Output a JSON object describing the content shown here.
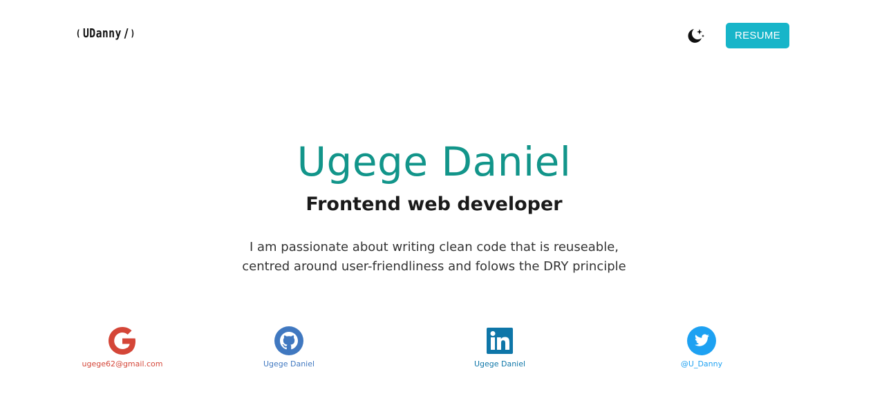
{
  "header": {
    "logo_open": "(",
    "logo_text": "UDanny",
    "logo_slash": "/",
    "logo_close": ")",
    "theme_icon": "moon-stars-icon",
    "resume_label": "RESUME"
  },
  "hero": {
    "name": "Ugege Daniel",
    "role": "Frontend web developer",
    "bio_line1": "I am passionate about writing clean code that is reuseable,",
    "bio_line2": "centred around user-friendliness and folows the DRY principle"
  },
  "socials": [
    {
      "icon": "google-icon",
      "label": "ugege62@gmail.com",
      "color": "#d44638"
    },
    {
      "icon": "github-icon",
      "label": "Ugege Daniel",
      "color": "#4078c0"
    },
    {
      "icon": "linkedin-icon",
      "label": "Ugege Daniel",
      "color": "#0e76a8"
    },
    {
      "icon": "twitter-icon",
      "label": "@U_Danny",
      "color": "#1da1f2"
    }
  ],
  "colors": {
    "accent": "#12958a",
    "button": "#17b5c9",
    "text": "#1a1a1a"
  }
}
